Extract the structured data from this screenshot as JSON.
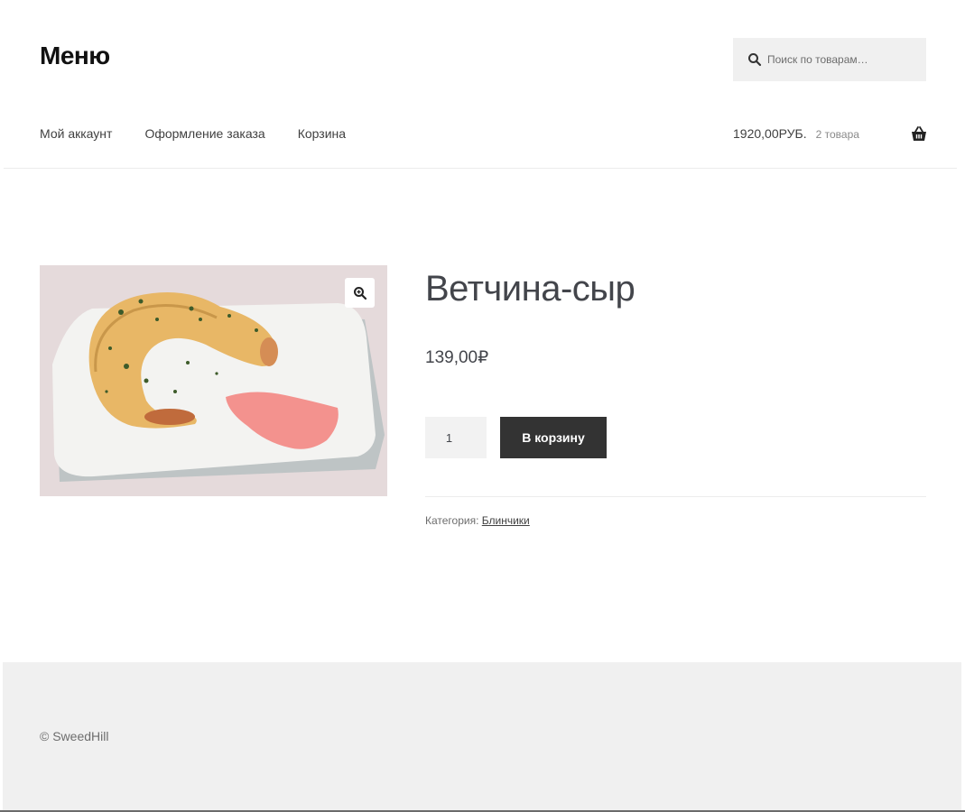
{
  "header": {
    "site_title": "Меню",
    "search_placeholder": "Поиск по товарам…"
  },
  "nav": {
    "items": [
      "Мой аккаунт",
      "Оформление заказа",
      "Корзина"
    ]
  },
  "cart": {
    "amount": "1920,00РУБ.",
    "count": "2 товара"
  },
  "product": {
    "title": "Ветчина-сыр",
    "price": "139,00₽",
    "quantity": "1",
    "add_to_cart_label": "В корзину",
    "category_label": "Категория:",
    "category_value": "Блинчики"
  },
  "footer": {
    "copyright": "© SweedHill"
  },
  "icons": {
    "search": "search-icon",
    "cart": "basket-icon",
    "zoom": "zoom-in-icon"
  },
  "colors": {
    "button_bg": "#333333",
    "footer_bg": "#f0f0f0",
    "search_bg": "#f0f0f0"
  }
}
